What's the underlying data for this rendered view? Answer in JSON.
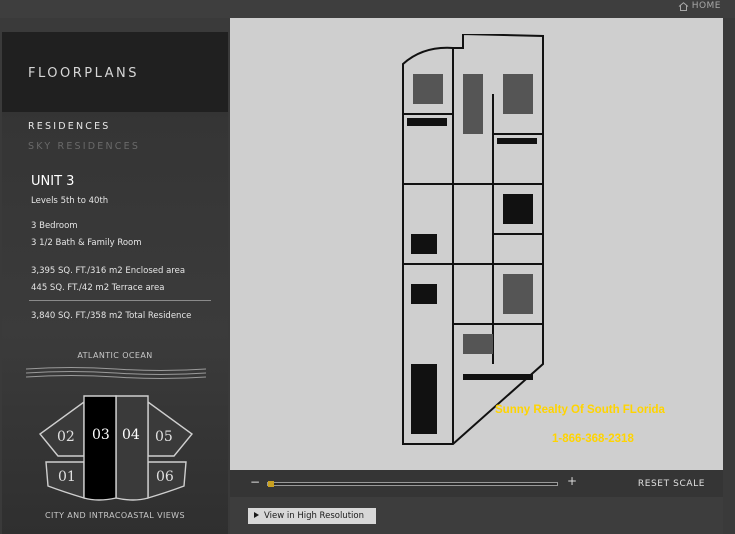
{
  "top": {
    "home_label": "HOME",
    "home_icon": "house-icon"
  },
  "sidebar": {
    "title": "FLOORPLANS",
    "nav": [
      {
        "label": "RESIDENCES",
        "active": true
      },
      {
        "label": "SKY RESIDENCES",
        "active": false
      }
    ],
    "unit": {
      "name": "UNIT 3",
      "levels": "Levels 5th to 40th",
      "bedrooms": "3 Bedroom",
      "baths": "3 1/2 Bath & Family Room",
      "enclosed": "3,395 SQ. FT./316 m2 Enclosed area",
      "terrace": "445 SQ. FT./42 m2 Terrace area",
      "total": "3,840 SQ. FT./358 m2 Total Residence"
    },
    "keyplan": {
      "top_label": "ATLANTIC OCEAN",
      "bottom_label": "CITY AND INTRACOASTAL VIEWS",
      "units": [
        "02",
        "03",
        "04",
        "05",
        "01",
        "06"
      ],
      "selected": "03"
    }
  },
  "viewer": {
    "overlay_company": "Sunny Realty Of South FLorida",
    "overlay_phone": "1-866-368-2318",
    "overlay_color": "#ffd400",
    "zoom_minus": "−",
    "zoom_plus": "+",
    "zoom_level": 0.0,
    "reset_label": "RESET SCALE",
    "hires_label": "View in High Resolution"
  },
  "colors": {
    "accent": "#c8a020",
    "selected_unit": "#000000"
  }
}
